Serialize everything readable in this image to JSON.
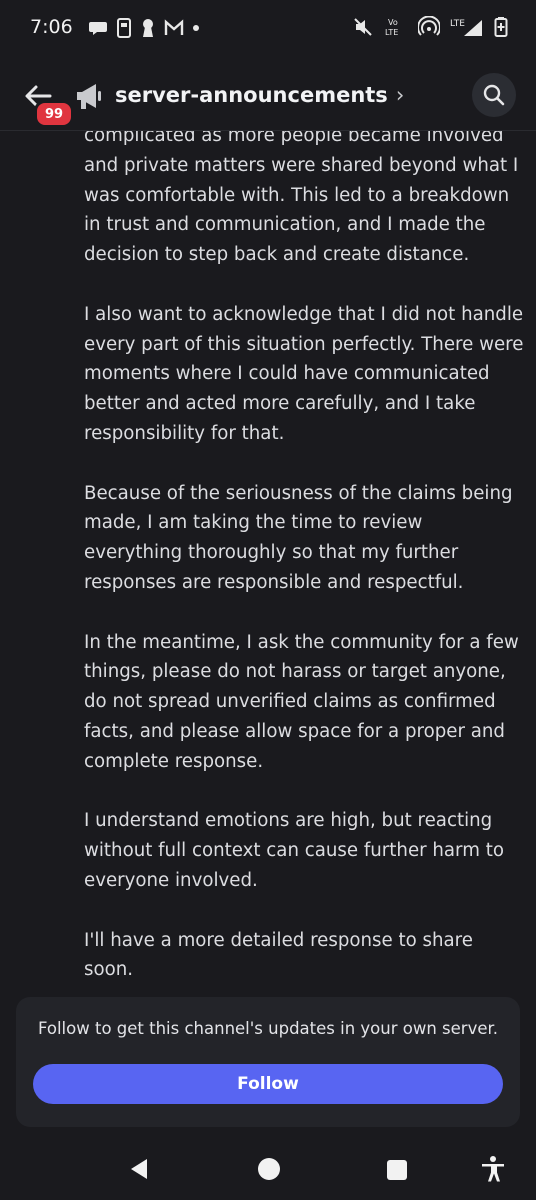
{
  "status_bar": {
    "time": "7:06",
    "left_icons": [
      "chat-bubble-icon",
      "phone-card-icon",
      "keyhole-icon",
      "gmail-icon",
      "dot-icon"
    ],
    "right_icons": [
      "muted-icon",
      "volte-icon",
      "hotspot-icon",
      "lte-signal-icon",
      "battery-icon"
    ],
    "volte_label": "Vo LTE",
    "lte_label": "LTE"
  },
  "header": {
    "unread_badge": "99",
    "channel_name": "server-announcements",
    "chevron": "›"
  },
  "message": {
    "paragraphs": [
      "complicated as more people became involved and private matters were shared beyond what I was comfortable with. This led to a breakdown in trust and communication, and I made the decision to step back and create distance.",
      "I also want to acknowledge that I did not handle every part of this situation perfectly. There were moments where I could have communicated better and acted more carefully, and I take responsibility for that.",
      "Because of the seriousness of the claims being made, I am taking the time to review everything thoroughly so that my further responses are responsible and respectful.",
      "In the meantime, I ask the community for a few things, please do not harass or target anyone, do not spread unverified claims as confirmed facts, and please allow space for a proper and complete response.",
      "I understand emotions are high, but reacting without full context can cause further harm to everyone involved.",
      "I'll have a more detailed response to share soon."
    ]
  },
  "follow_card": {
    "text": "Follow to get this channel's updates in your own server.",
    "button_label": "Follow"
  },
  "colors": {
    "background": "#1a1a1e",
    "accent": "#5865f2",
    "badge": "#e0353f"
  }
}
